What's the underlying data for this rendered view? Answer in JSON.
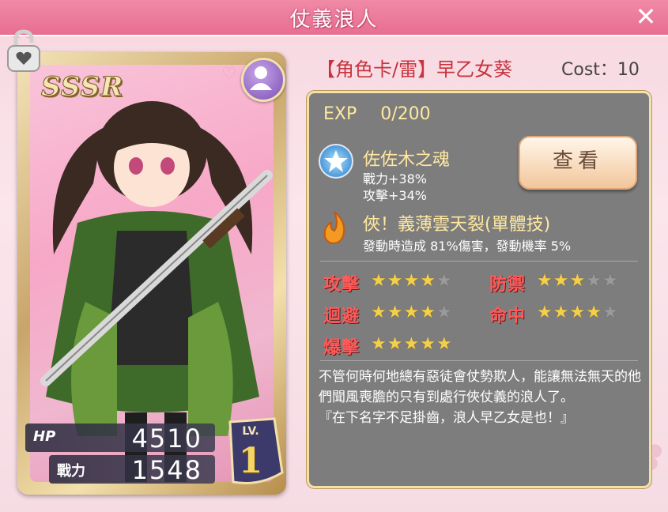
{
  "window": {
    "title": "仗義浪人"
  },
  "card": {
    "rarity": "SSSR",
    "hp_label": "HP",
    "hp": "4510",
    "power_label": "戰力",
    "power": "1548",
    "level_label": "LV.",
    "level": "1"
  },
  "header": {
    "card_name": "【角色卡/雷】早乙女葵",
    "cost": "Cost：10"
  },
  "panel": {
    "exp_label": "EXP",
    "exp_value": "0/200",
    "skill1": {
      "name": "佐佐木之魂",
      "line1": "戰力+38%",
      "line2": "攻擊+34%"
    },
    "view_button": "查看",
    "skill2": {
      "name": "俠！義薄雲天裂(單體技)",
      "desc": "發動時造成 81%傷害，發動機率 5%"
    },
    "stats": [
      {
        "label": "攻擊",
        "stars": 4
      },
      {
        "label": "防禦",
        "stars": 3
      },
      {
        "label": "迴避",
        "stars": 4
      },
      {
        "label": "命中",
        "stars": 4
      },
      {
        "label": "爆擊",
        "stars": 5
      }
    ],
    "description": "不管何時何地總有惡徒會仗勢欺人，能讓無法無天的他們聞風喪膽的只有到處行俠仗義的浪人了。\n『在下名字不足掛齒，浪人早乙女是也！』"
  },
  "colors": {
    "title_bar": "#e86e91",
    "panel_bg": "#7d7d7d",
    "accent_gold": "#ffe9a0",
    "stat_red": "#ff5a5a"
  }
}
